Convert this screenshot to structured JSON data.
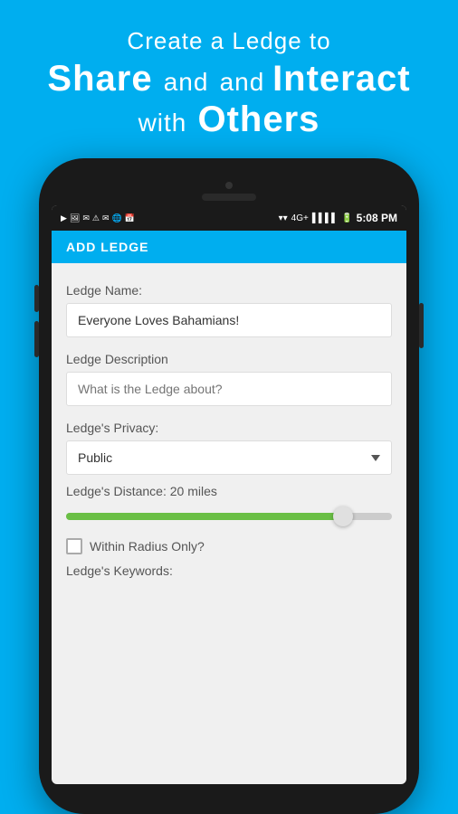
{
  "header": {
    "line1": "Create  a  Ledge  to",
    "line2_share": "Share",
    "line2_and": "and",
    "line2_interact": "Interact",
    "line2_with": "with",
    "line2_others": "Others"
  },
  "status_bar": {
    "time": "5:08 PM",
    "signal": "4G+",
    "battery": "100"
  },
  "app_bar": {
    "title": "ADD LEDGE"
  },
  "form": {
    "ledge_name_label": "Ledge Name:",
    "ledge_name_value": "Everyone Loves Bahamians!",
    "ledge_description_label": "Ledge Description",
    "ledge_description_placeholder": "What is the Ledge about?",
    "privacy_label": "Ledge's Privacy:",
    "privacy_value": "Public",
    "distance_label": "Ledge's Distance: 20 miles",
    "slider_percent": 85,
    "within_radius_label": "Within Radius Only?",
    "keywords_label": "Ledge's Keywords:"
  }
}
